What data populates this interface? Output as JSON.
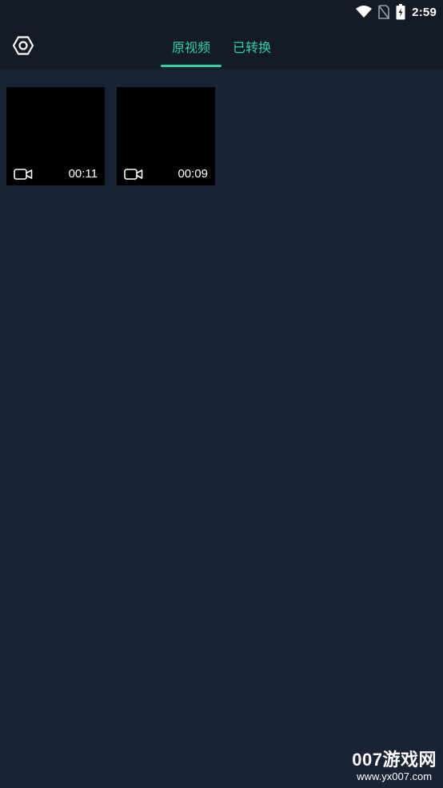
{
  "status_bar": {
    "time": "2:59",
    "icons": [
      "wifi-icon",
      "no-sim-icon",
      "battery-charging-icon"
    ]
  },
  "app_bar": {
    "settings_icon": "settings-hex-icon",
    "tabs": [
      {
        "label": "原视频",
        "selected": true
      },
      {
        "label": "已转换",
        "selected": false
      }
    ],
    "accent_color": "#2fd1a6"
  },
  "videos": [
    {
      "duration": "00:11",
      "icon": "video-camera-icon"
    },
    {
      "duration": "00:09",
      "icon": "video-camera-icon"
    }
  ],
  "watermark": {
    "brand": "007游戏网",
    "url": "www.yx007.com"
  },
  "colors": {
    "background": "#1a2333",
    "bar_background": "#141b27",
    "thumbnail": "#000000"
  }
}
